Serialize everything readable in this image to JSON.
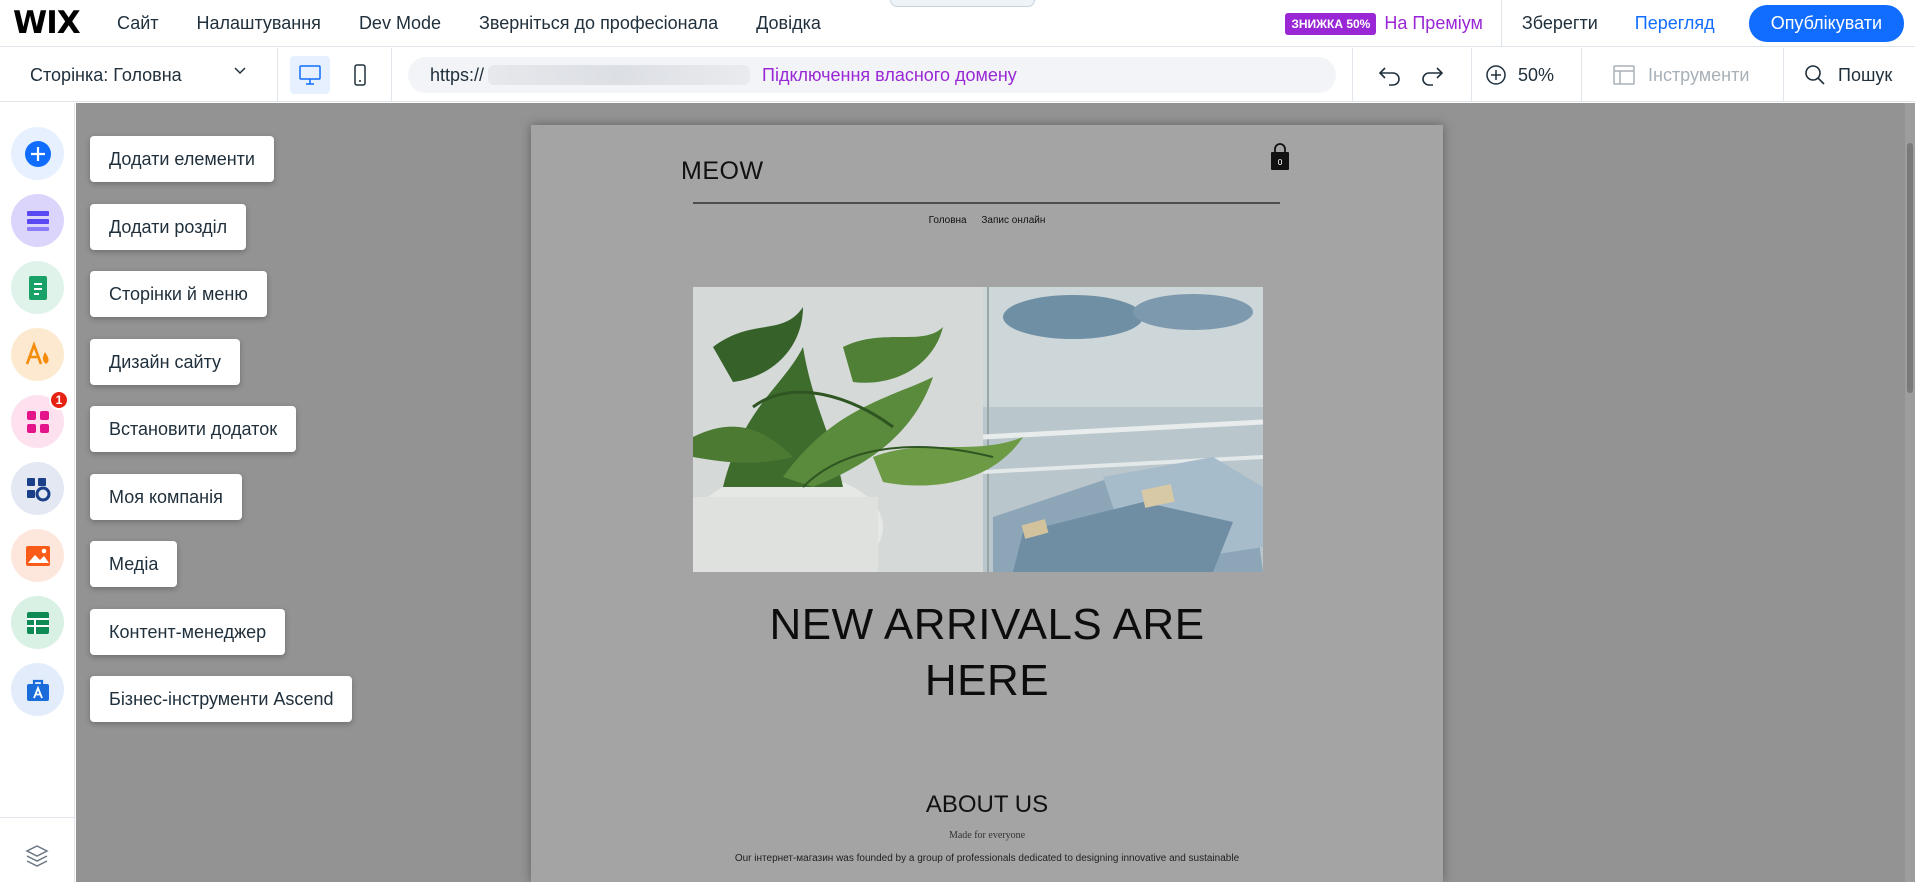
{
  "app": {
    "logo": "WIX"
  },
  "menu": [
    "Сайт",
    "Налаштування",
    "Dev Mode",
    "Зверніться до професіонала",
    "Довідка"
  ],
  "header": {
    "sale_badge": "ЗНИЖКА 50%",
    "premium": "На Преміум",
    "save": "Зберегти",
    "preview": "Перегляд",
    "publish": "Опублікувати"
  },
  "subbar": {
    "page_label": "Сторінка: Головна",
    "url_prefix": "https://",
    "connect_domain": "Підключення власного домену",
    "zoom": "50%",
    "tools": "Інструменти",
    "search": "Пошук"
  },
  "rail": {
    "items": [
      "Додати елементи",
      "Додати розділ",
      "Сторінки й меню",
      "Дизайн сайту",
      "Встановити додаток",
      "Моя компанія",
      "Медіа",
      "Контент-менеджер",
      "Бізнес-інструменти Ascend"
    ],
    "apps_badge": "1"
  },
  "site": {
    "logo": "MEOW",
    "nav": [
      "Головна",
      "Запис онлайн"
    ],
    "hero_title_line1": "NEW ARRIVALS ARE",
    "hero_title_line2": "HERE",
    "about_title": "ABOUT US",
    "about_subtitle": "Made for everyone",
    "about_text": "Our інтернет-магазин was founded by a group of professionals dedicated to designing innovative and sustainable"
  },
  "colors": {
    "accent_blue": "#116dff",
    "premium_purple": "#9a27d5",
    "workspace_gray": "#939393"
  }
}
